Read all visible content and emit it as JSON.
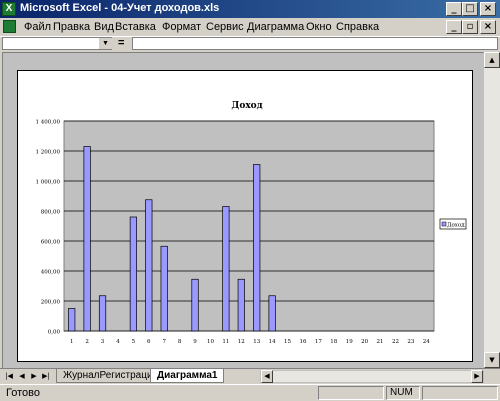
{
  "window": {
    "title": "Microsoft Excel - 04-Учет доходов.xls",
    "app_icon": "excel-icon",
    "buttons": [
      "minimize",
      "maximize",
      "close"
    ]
  },
  "doc_buttons": [
    "minimize",
    "restore",
    "close"
  ],
  "menu": {
    "items": [
      "Файл",
      "Правка",
      "Вид",
      "Вставка",
      "Формат",
      "Сервис",
      "Диаграмма",
      "Окно",
      "Справка"
    ]
  },
  "formula_bar": {
    "name_box": "",
    "equals": "=",
    "content": ""
  },
  "chart_data": {
    "type": "bar",
    "title": "Доход",
    "categories": [
      "1",
      "2",
      "3",
      "4",
      "5",
      "6",
      "7",
      "8",
      "9",
      "10",
      "11",
      "12",
      "13",
      "14",
      "15",
      "16",
      "17",
      "18",
      "19",
      "20",
      "21",
      "22",
      "23",
      "24"
    ],
    "series": [
      {
        "name": "Доход",
        "values": [
          150,
          1230,
          235,
          0,
          760,
          875,
          565,
          0,
          345,
          0,
          830,
          345,
          1110,
          235,
          0,
          0,
          0,
          0,
          0,
          0,
          0,
          0,
          0,
          0
        ]
      }
    ],
    "yticks": [
      "0,00",
      "200,00",
      "400,00",
      "600,00",
      "800,00",
      "1 000,00",
      "1 200,00",
      "1 400,00"
    ],
    "ylim": [
      0,
      1400
    ],
    "grid": true,
    "legend": "right",
    "colors": {
      "bar": "#9999ff",
      "plot_bg": "#c0c0c0",
      "chart_bg": "#ffffff",
      "grid": "#000000"
    }
  },
  "sheet_tabs": [
    {
      "label": "ЖурналРегистраций",
      "active": false
    },
    {
      "label": "Диаграмма1",
      "active": true
    }
  ],
  "status": {
    "ready": "Готово",
    "num": "NUM"
  }
}
